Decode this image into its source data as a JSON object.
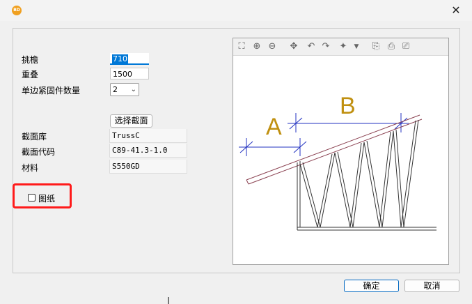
{
  "window": {
    "app_icon_text": "BD",
    "close_glyph": "✕"
  },
  "form": {
    "overhang_label": "挑檐",
    "overhang_value": "710",
    "overlap_label": "重叠",
    "overlap_value": "1500",
    "fastener_label": "单边紧固件数量",
    "fastener_value": "2",
    "select_section_label": "选择截面",
    "section_lib_label": "截面库",
    "section_lib_value": "TrussC",
    "section_code_label": "截面代码",
    "section_code_value": "C89-41.3-1.0",
    "material_label": "材料",
    "material_value": "S550GD",
    "drawing_checkbox_label": "图纸",
    "drawing_checked": false
  },
  "viewer": {
    "toolbar_icons": [
      "fit-icon",
      "zoom-in-icon",
      "zoom-out-icon",
      "pan-icon",
      "rotate-left-icon",
      "rotate-right-icon",
      "view-icon",
      "dropdown-icon",
      "copy-icon",
      "export-icon",
      "print-icon"
    ],
    "label_a": "A",
    "label_b": "B",
    "dim_color": "#2030c0",
    "label_color": "#c09010",
    "member_color": "#8a4050"
  },
  "buttons": {
    "ok_label": "确定",
    "cancel_label": "取消"
  }
}
